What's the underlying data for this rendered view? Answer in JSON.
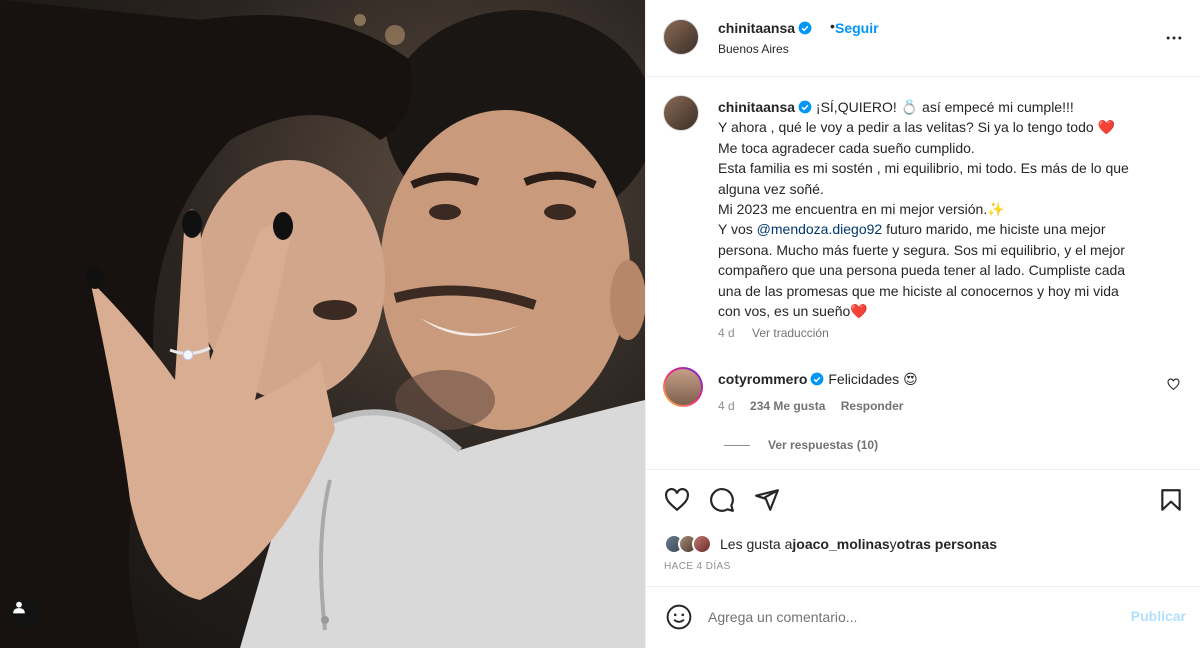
{
  "photo": {
    "alt_icon": "user-tag-icon"
  },
  "header": {
    "username": "chinitaansa",
    "separator": "•",
    "follow_label": "Seguir",
    "location": "Buenos Aires",
    "more_icon": "more-dots-icon"
  },
  "caption": {
    "username": "chinitaansa",
    "lines": [
      "¡SÍ,QUIERO! 💍  así empecé mi cumple!!!",
      "Y ahora , qué le voy a pedir a las velitas? Si ya lo tengo todo ❤️",
      "Me toca agradecer cada sueño cumplido.",
      "Esta familia es mi sostén , mi equilibrio, mi todo. Es más de lo que alguna vez soñé.",
      "Mi 2023 me encuentra en mi mejor versión.✨"
    ],
    "last_prefix": "Y vos ",
    "mention": "@mendoza.diego92",
    "last_suffix": " futuro marido, me hiciste una mejor persona. Mucho más fuerte y segura. Sos mi equilibrio, y el mejor compañero que una persona pueda tener al lado. Cumpliste cada una de las promesas que me hiciste al conocernos y hoy mi vida con vos, es un sueño❤️",
    "age": "4 d",
    "translate_label": "Ver traducción"
  },
  "comment": {
    "username": "cotyrommero",
    "text": "Felicidades 😍",
    "age": "4 d",
    "likes": "234 Me gusta",
    "reply_label": "Responder",
    "view_replies": "Ver respuestas (10)"
  },
  "likes": {
    "prefix": "Les gusta a ",
    "user": "joaco_molinas",
    "middle": " y ",
    "others": "otras personas"
  },
  "time_ago": "HACE 4 DÍAS",
  "add_comment": {
    "placeholder": "Agrega un comentario...",
    "publish_label": "Publicar"
  },
  "colors": {
    "accent": "#0095f6",
    "publish_disabled": "#b2dffc",
    "verified": "#0095f6"
  }
}
